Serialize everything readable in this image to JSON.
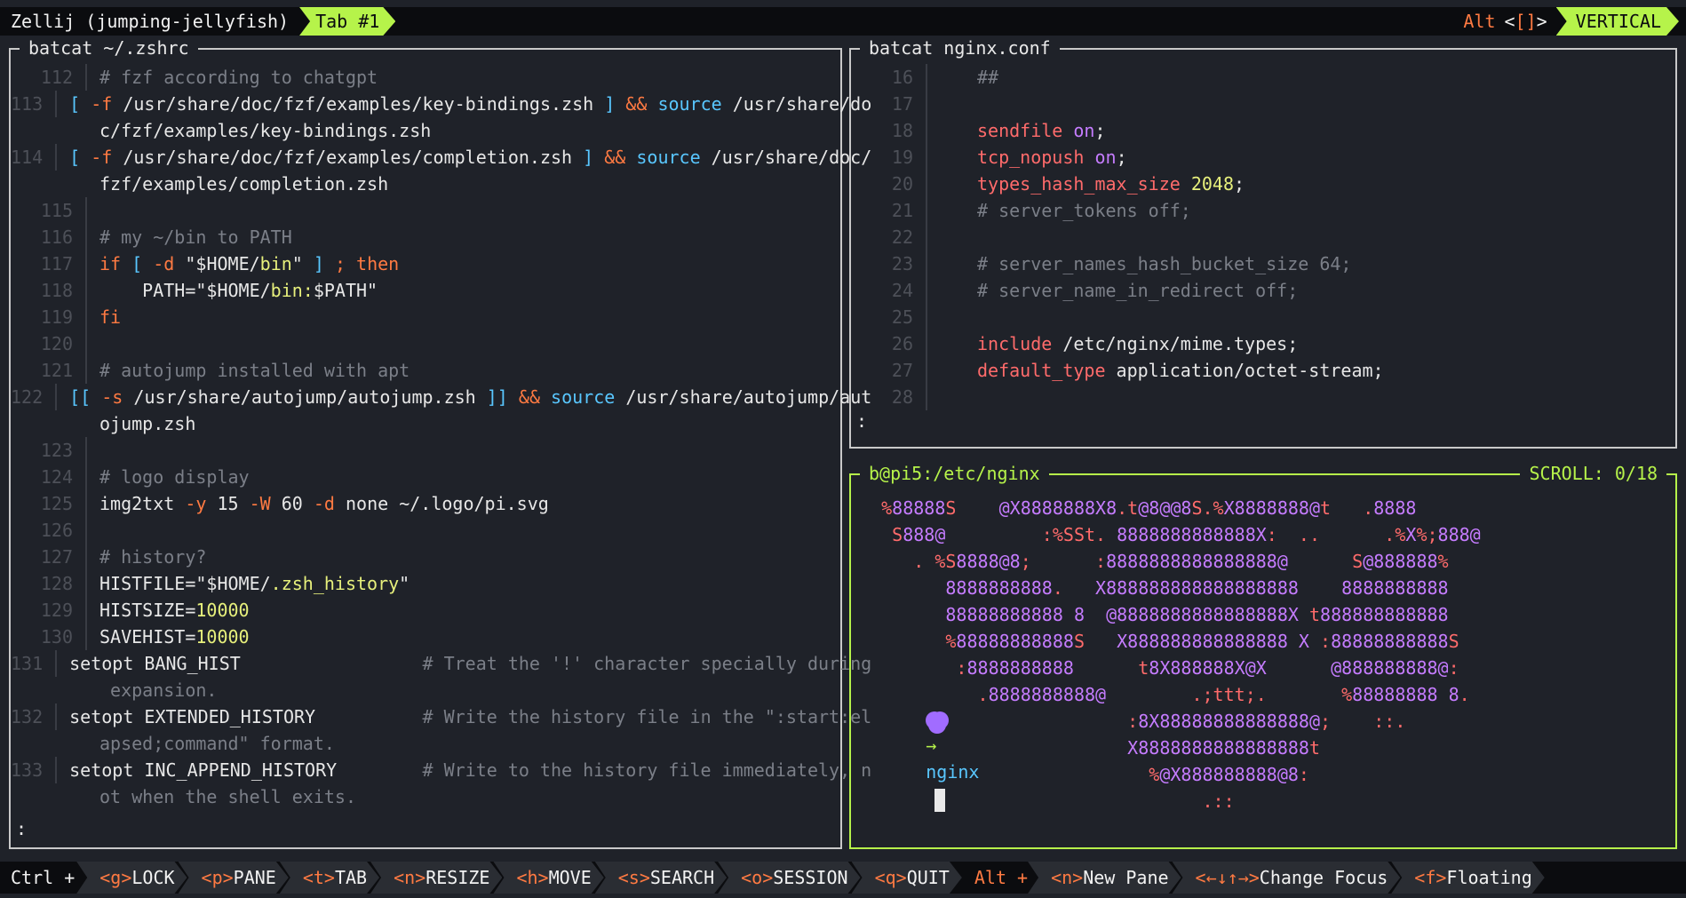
{
  "top_bar": {
    "session_title": "Zellij (jumping-jellyfish)",
    "tab_label": "Tab #1",
    "alt_hint": {
      "alt": "Alt",
      "bracket_left": "<",
      "bracket_inner": "[]",
      "bracket_right": ">"
    },
    "layout_label": "VERTICAL"
  },
  "left_pane": {
    "title": "batcat ~/.zshrc",
    "prompt_marker": ":",
    "lines": [
      {
        "n": "112",
        "parts": [
          {
            "cls": "c",
            "t": "# fzf according to chatgpt"
          }
        ]
      },
      {
        "n": "113",
        "parts": [
          {
            "cls": "b",
            "t": "[ "
          },
          {
            "cls": "o",
            "t": "-f"
          },
          {
            "cls": "t",
            "t": " /usr/share/doc/fzf/examples/key-bindings.zsh "
          },
          {
            "cls": "b",
            "t": "]"
          },
          {
            "cls": "t",
            "t": " "
          },
          {
            "cls": "o",
            "t": "&&"
          },
          {
            "cls": "t",
            "t": " "
          },
          {
            "cls": "b",
            "t": "source"
          },
          {
            "cls": "t",
            "t": " /usr/share/do"
          }
        ]
      },
      {
        "n": "",
        "parts": [
          {
            "cls": "t",
            "t": "c/fzf/examples/key-bindings.zsh"
          }
        ]
      },
      {
        "n": "114",
        "parts": [
          {
            "cls": "b",
            "t": "[ "
          },
          {
            "cls": "o",
            "t": "-f"
          },
          {
            "cls": "t",
            "t": " /usr/share/doc/fzf/examples/completion.zsh "
          },
          {
            "cls": "b",
            "t": "]"
          },
          {
            "cls": "t",
            "t": " "
          },
          {
            "cls": "o",
            "t": "&&"
          },
          {
            "cls": "t",
            "t": " "
          },
          {
            "cls": "b",
            "t": "source"
          },
          {
            "cls": "t",
            "t": " /usr/share/doc/"
          }
        ]
      },
      {
        "n": "",
        "parts": [
          {
            "cls": "t",
            "t": "fzf/examples/completion.zsh"
          }
        ]
      },
      {
        "n": "115",
        "parts": [
          {
            "cls": "t",
            "t": ""
          }
        ]
      },
      {
        "n": "116",
        "parts": [
          {
            "cls": "c",
            "t": "# my ~/bin to PATH"
          }
        ]
      },
      {
        "n": "117",
        "parts": [
          {
            "cls": "o",
            "t": "if"
          },
          {
            "cls": "t",
            "t": " "
          },
          {
            "cls": "b",
            "t": "["
          },
          {
            "cls": "t",
            "t": " "
          },
          {
            "cls": "o",
            "t": "-d"
          },
          {
            "cls": "t",
            "t": " \"$HOME/"
          },
          {
            "cls": "y",
            "t": "bin"
          },
          {
            "cls": "t",
            "t": "\" "
          },
          {
            "cls": "b",
            "t": "]"
          },
          {
            "cls": "t",
            "t": " "
          },
          {
            "cls": "o",
            "t": "; then"
          }
        ]
      },
      {
        "n": "118",
        "parts": [
          {
            "cls": "t",
            "t": "    PATH="
          },
          {
            "cls": "t",
            "t": "\"$HOME/"
          },
          {
            "cls": "y",
            "t": "bin:"
          },
          {
            "cls": "t",
            "t": "$PATH\""
          }
        ]
      },
      {
        "n": "119",
        "parts": [
          {
            "cls": "o",
            "t": "fi"
          }
        ]
      },
      {
        "n": "120",
        "parts": [
          {
            "cls": "t",
            "t": ""
          }
        ]
      },
      {
        "n": "121",
        "parts": [
          {
            "cls": "c",
            "t": "# autojump installed with apt"
          }
        ]
      },
      {
        "n": "122",
        "parts": [
          {
            "cls": "b",
            "t": "[["
          },
          {
            "cls": "t",
            "t": " "
          },
          {
            "cls": "o",
            "t": "-s"
          },
          {
            "cls": "t",
            "t": " /usr/share/autojump/autojump.zsh "
          },
          {
            "cls": "b",
            "t": "]]"
          },
          {
            "cls": "t",
            "t": " "
          },
          {
            "cls": "o",
            "t": "&&"
          },
          {
            "cls": "t",
            "t": " "
          },
          {
            "cls": "b",
            "t": "source"
          },
          {
            "cls": "t",
            "t": " /usr/share/autojump/aut"
          }
        ]
      },
      {
        "n": "",
        "parts": [
          {
            "cls": "t",
            "t": "ojump.zsh"
          }
        ]
      },
      {
        "n": "123",
        "parts": [
          {
            "cls": "t",
            "t": ""
          }
        ]
      },
      {
        "n": "124",
        "parts": [
          {
            "cls": "c",
            "t": "# logo display"
          }
        ]
      },
      {
        "n": "125",
        "parts": [
          {
            "cls": "t",
            "t": "img2txt "
          },
          {
            "cls": "o",
            "t": "-y"
          },
          {
            "cls": "t",
            "t": " 15 "
          },
          {
            "cls": "o",
            "t": "-W"
          },
          {
            "cls": "t",
            "t": " 60 "
          },
          {
            "cls": "o",
            "t": "-d"
          },
          {
            "cls": "t",
            "t": " none ~/.logo/pi.svg"
          }
        ]
      },
      {
        "n": "126",
        "parts": [
          {
            "cls": "t",
            "t": ""
          }
        ]
      },
      {
        "n": "127",
        "parts": [
          {
            "cls": "c",
            "t": "# history?"
          }
        ]
      },
      {
        "n": "128",
        "parts": [
          {
            "cls": "t",
            "t": "HISTFILE="
          },
          {
            "cls": "t",
            "t": "\"$HOME/"
          },
          {
            "cls": "y",
            "t": ".zsh_history"
          },
          {
            "cls": "t",
            "t": "\""
          }
        ]
      },
      {
        "n": "129",
        "parts": [
          {
            "cls": "t",
            "t": "HISTSIZE="
          },
          {
            "cls": "y",
            "t": "10000"
          }
        ]
      },
      {
        "n": "130",
        "parts": [
          {
            "cls": "t",
            "t": "SAVEHIST="
          },
          {
            "cls": "y",
            "t": "10000"
          }
        ]
      },
      {
        "n": "131",
        "parts": [
          {
            "cls": "t",
            "t": "setopt BANG_HIST"
          },
          {
            "cls": "t",
            "t": "                 "
          },
          {
            "cls": "c",
            "t": "# Treat the '!' character specially during"
          }
        ]
      },
      {
        "n": "",
        "parts": [
          {
            "cls": "c",
            "t": " expansion."
          }
        ]
      },
      {
        "n": "132",
        "parts": [
          {
            "cls": "t",
            "t": "setopt EXTENDED_HISTORY"
          },
          {
            "cls": "t",
            "t": "          "
          },
          {
            "cls": "c",
            "t": "# Write the history file in the \":start:el"
          }
        ]
      },
      {
        "n": "",
        "parts": [
          {
            "cls": "c",
            "t": "apsed;command\" format."
          }
        ]
      },
      {
        "n": "133",
        "parts": [
          {
            "cls": "t",
            "t": "setopt INC_APPEND_HISTORY"
          },
          {
            "cls": "t",
            "t": "        "
          },
          {
            "cls": "c",
            "t": "# Write to the history file immediately, n"
          }
        ]
      },
      {
        "n": "",
        "parts": [
          {
            "cls": "c",
            "t": "ot when the shell exits."
          }
        ]
      }
    ]
  },
  "right_top_pane": {
    "title": "batcat nginx.conf",
    "prompt_marker": ":",
    "lines": [
      {
        "n": "16",
        "parts": [
          {
            "cls": "c",
            "t": "##"
          }
        ]
      },
      {
        "n": "17",
        "parts": [
          {
            "cls": "t",
            "t": ""
          }
        ]
      },
      {
        "n": "18",
        "parts": [
          {
            "cls": "p",
            "t": "sendfile"
          },
          {
            "cls": "t",
            "t": " "
          },
          {
            "cls": "purple",
            "t": "on"
          },
          {
            "cls": "t",
            "t": ";"
          }
        ]
      },
      {
        "n": "19",
        "parts": [
          {
            "cls": "p",
            "t": "tcp_nopush"
          },
          {
            "cls": "t",
            "t": " "
          },
          {
            "cls": "purple",
            "t": "on"
          },
          {
            "cls": "t",
            "t": ";"
          }
        ]
      },
      {
        "n": "20",
        "parts": [
          {
            "cls": "p",
            "t": "types_hash_max_size"
          },
          {
            "cls": "t",
            "t": " "
          },
          {
            "cls": "y",
            "t": "2048"
          },
          {
            "cls": "t",
            "t": ";"
          }
        ]
      },
      {
        "n": "21",
        "parts": [
          {
            "cls": "c",
            "t": "# server_tokens off;"
          }
        ]
      },
      {
        "n": "22",
        "parts": [
          {
            "cls": "t",
            "t": ""
          }
        ]
      },
      {
        "n": "23",
        "parts": [
          {
            "cls": "c",
            "t": "# server_names_hash_bucket_size 64;"
          }
        ]
      },
      {
        "n": "24",
        "parts": [
          {
            "cls": "c",
            "t": "# server_name_in_redirect off;"
          }
        ]
      },
      {
        "n": "25",
        "parts": [
          {
            "cls": "t",
            "t": ""
          }
        ]
      },
      {
        "n": "26",
        "parts": [
          {
            "cls": "p",
            "t": "include"
          },
          {
            "cls": "t",
            "t": " /etc/nginx/mime.types;"
          }
        ]
      },
      {
        "n": "27",
        "parts": [
          {
            "cls": "p",
            "t": "default_type"
          },
          {
            "cls": "t",
            "t": " application/octet-stream;"
          }
        ]
      },
      {
        "n": "28",
        "parts": [
          {
            "cls": "t",
            "t": ""
          }
        ]
      }
    ]
  },
  "right_bottom_pane": {
    "title": "b@pi5:/etc/nginx",
    "scroll_label": "SCROLL:",
    "scroll_value": "0/18",
    "art_lines": [
      "  %88888S    @X8888888X8.t@8@@8S.%X8888888@t   .8888",
      "   S888@         :%SSt. 8888888888888X:  ..      .%X%;888@",
      "     . %S8888@8;      :8888888888888888@      S@888888%",
      "        8888888888.   X888888888888888888    8888888888",
      "        88888888888 8  @8888888888888888X t888888888888",
      "        %88888888888S   X888888888888888 X :88888888888S",
      "         :8888888888      t8X888888X@X      @888888888@:",
      "           .8888888888@        .;ttt;.       %88888888 8.",
      "                         :8X88888888888888@;    ::.",
      "                         X8888888888888888t",
      "                           %@X888888888@8:",
      "                                .::"
    ],
    "prompt_dir": "nginx"
  },
  "status_bar": {
    "ctrl": "Ctrl +",
    "chips": [
      {
        "key": "<g>",
        "label": "LOCK"
      },
      {
        "key": "<p>",
        "label": "PANE"
      },
      {
        "key": "<t>",
        "label": "TAB"
      },
      {
        "key": "<n>",
        "label": "RESIZE"
      },
      {
        "key": "<h>",
        "label": "MOVE"
      },
      {
        "key": "<s>",
        "label": "SEARCH"
      },
      {
        "key": "<o>",
        "label": "SESSION"
      },
      {
        "key": "<q>",
        "label": "QUIT"
      }
    ],
    "alt": "Alt +",
    "alt_chips": [
      {
        "key": "<n>",
        "label": "New Pane"
      },
      {
        "key": "<←↓↑→>",
        "label": "Change Focus"
      },
      {
        "key": "<f>",
        "label": "Floating"
      }
    ]
  },
  "colors": {
    "accent_green": "#b6f34a",
    "accent_orange": "#ff7a42",
    "blue": "#59c7ff",
    "pink": "#ff6b6b",
    "comment": "#7b7f88"
  },
  "icons": {
    "prompt_icon": "grape-icon",
    "prompt_arrow": "right-arrow-icon"
  }
}
